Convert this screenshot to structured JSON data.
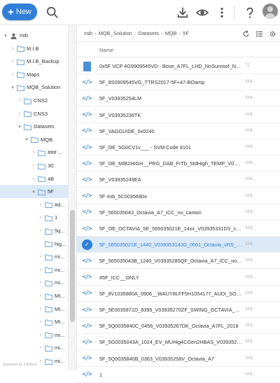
{
  "toolbar": {
    "new_label": "New",
    "icons": [
      "search-icon",
      "download-icon",
      "eye-icon",
      "more-vertical-icon",
      "help-icon",
      "user-avatar"
    ]
  },
  "sidebar": {
    "items": [
      {
        "label": "mib",
        "level": 0,
        "icon": "user",
        "chevron": "▾"
      },
      {
        "label": "M.I.B",
        "level": 1,
        "chevron": "›"
      },
      {
        "label": "M.I.B_Backup",
        "level": 1,
        "chevron": "›"
      },
      {
        "label": "Maps",
        "level": 1,
        "chevron": "›"
      },
      {
        "label": "MQB_Solution",
        "level": 1,
        "chevron": "▾"
      },
      {
        "label": "CNS2",
        "level": 2,
        "chevron": "›"
      },
      {
        "label": "CNS3",
        "level": 2,
        "chevron": "›"
      },
      {
        "label": "Datasets",
        "level": 2,
        "chevron": "▾"
      },
      {
        "label": "MQB",
        "level": 3,
        "chevron": "▾"
      },
      {
        "label": "### ...",
        "level": 4,
        "chevron": "›"
      },
      {
        "label": "3C",
        "level": 4,
        "chevron": "›"
      },
      {
        "label": "4B",
        "level": 4,
        "chevron": "›"
      },
      {
        "label": "5F",
        "level": 4,
        "chevron": "▾",
        "selected": true
      },
      {
        "label": "#d...",
        "level": 5,
        "chevron": "›"
      },
      {
        "label": "1",
        "level": 5,
        "chevron": "›"
      },
      {
        "label": "5q...",
        "level": 5,
        "chevron": "›"
      },
      {
        "label": "hig...",
        "level": 5,
        "chevron": ""
      },
      {
        "label": "mi...",
        "level": 5,
        "chevron": "›"
      },
      {
        "label": "mi...",
        "level": 5,
        "chevron": "›"
      },
      {
        "label": "mi...",
        "level": 5,
        "chevron": "›"
      },
      {
        "label": "MI...",
        "level": 5,
        "chevron": "›"
      },
      {
        "label": "MI...",
        "level": 5,
        "chevron": "›"
      },
      {
        "label": "MI...",
        "level": 5,
        "chevron": "›"
      },
      {
        "label": "mi...",
        "level": 5,
        "chevron": "›"
      },
      {
        "label": "mi...",
        "level": 5,
        "chevron": "›"
      },
      {
        "label": "mi...",
        "level": 5,
        "chevron": "›"
      }
    ],
    "footer": "powered by FileRun"
  },
  "breadcrumb": [
    "mib",
    "MQB_Solution",
    "Datasets",
    "MQB",
    "5F"
  ],
  "columns": {
    "name": "Name"
  },
  "files": [
    {
      "name": "0x5F VCP 4G9909545VD - Bose_A7FL_LHD_NoSunroof_NoANC...",
      "type": "7Z",
      "icon": "archive"
    },
    {
      "name": "5F_8S0909545VG_TTRS2017-5F+47-BOamp",
      "type": "XML",
      "icon": "code"
    },
    {
      "name": "5F_V03935254LM",
      "type": "XML",
      "icon": "code"
    },
    {
      "name": "5F_V03935236TK",
      "type": "XML",
      "icon": "code"
    },
    {
      "name": "5F_VAGGUIDE_0x0240",
      "type": "XML",
      "icon": "code"
    },
    {
      "name": "5F_OE_5G0CV1v___ - SVM Code 9101",
      "type": "XML",
      "icon": "code"
    },
    {
      "name": "5F_OE_MIB2HIGH__PRG_DAB_FrTb_StdHigh_TEMP_V0.0_V039...",
      "type": "XML",
      "icon": "code"
    },
    {
      "name": "5F_V03935249EA",
      "type": "XML",
      "icon": "code"
    },
    {
      "name": "5F mib_5C0035680x",
      "type": "XML",
      "icon": "code"
    },
    {
      "name": "5F_565035043_Octavia_A7_ICC_no_canton",
      "type": "XML",
      "icon": "code"
    },
    {
      "name": "5F_OE_OCTAVIA_5E_565035021E_14xx_V03935331DS_canton...",
      "type": "XML",
      "icon": "code"
    },
    {
      "name": "5F_565035021E_1440_V03935314JG_0001_Octavia_vRS_NO_...",
      "type": "XML",
      "icon": "check",
      "selected": true
    },
    {
      "name": "5F_565035043B_1240_V03935285QF_Octavia_A7_ICC_no_can...",
      "type": "XML",
      "icon": "code"
    },
    {
      "name": "#5F_ICC__ONLY",
      "type": "XML",
      "icon": "code"
    },
    {
      "name": "5F_8V1035880A_0906__WAUY8LFF5H1054177_AUDI_SOUNDS...",
      "type": "XML",
      "icon": "code"
    },
    {
      "name": "5F_5E0035871D_8395_V03935270ZF_SWING_OCTAVIA_A7_20...",
      "type": "XML",
      "icon": "code"
    },
    {
      "name": "5F_5Q0035840C_0456_V03935267DK_Octavia_A7FL_2018",
      "type": "XML",
      "icon": "code"
    },
    {
      "name": "5F_5G0035043A_1024_EV_MUHig4CGen2HBAS_V03935284X...",
      "type": "XML",
      "icon": "code"
    },
    {
      "name": "5F_5Q0035840B_0363_V03935258V_Octavia_A7",
      "type": "XML",
      "icon": "code"
    },
    {
      "name": "1",
      "type": "XML",
      "icon": "code"
    }
  ],
  "colors": {
    "accent": "#2f7fd8",
    "selected_bg": "#dce9f7",
    "folder_stroke": "#5b9bd5"
  }
}
